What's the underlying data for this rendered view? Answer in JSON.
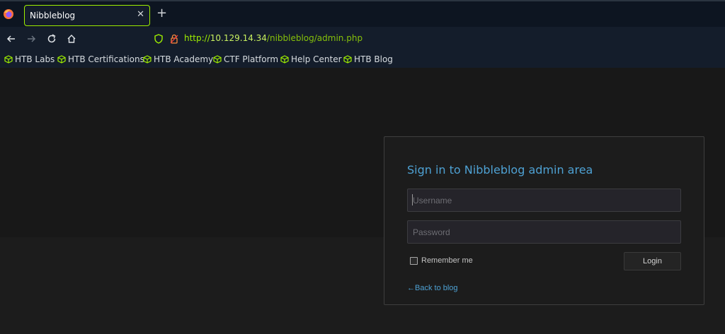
{
  "browser": {
    "tab_title": "Nibbleblog",
    "tab_close": "✕",
    "new_tab": "+",
    "url_scheme": "http://",
    "url_host": "10.129.14.34",
    "url_path": "/nibbleblog/admin.php",
    "bookmarks": [
      {
        "label": "HTB Labs"
      },
      {
        "label": "HTB Certifications"
      },
      {
        "label": "HTB Academy"
      },
      {
        "label": "CTF Platform"
      },
      {
        "label": "Help Center"
      },
      {
        "label": "HTB Blog"
      }
    ],
    "accent_color": "#9fef00"
  },
  "login": {
    "title": "Sign in to Nibbleblog admin area",
    "username_placeholder": "Username",
    "password_placeholder": "Password",
    "remember_label": "Remember me",
    "login_button": "Login",
    "back_link": "←Back to blog",
    "link_color": "#4ea1d3"
  }
}
